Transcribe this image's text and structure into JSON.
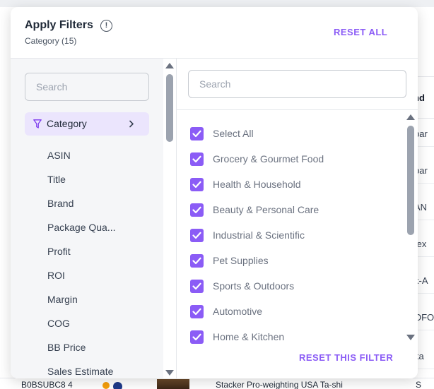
{
  "background": {
    "column_header": "nd",
    "cells": [
      "bar",
      "bar",
      "AN",
      "tex",
      "k-A",
      "OFO",
      "ka",
      "S"
    ],
    "bottom_row_id": "B0BSUBC8 4",
    "bottom_row_text": "Stacker Pro-weighting USA Ta-shi"
  },
  "panel": {
    "title": "Apply Filters",
    "subtitle": "Category (15)",
    "info_icon_glyph": "!",
    "reset_all_label": "RESET ALL",
    "reset_filter_label": "RESET THIS FILTER"
  },
  "left": {
    "search_placeholder": "Search",
    "active_item": "Category",
    "items": [
      "ASIN",
      "Title",
      "Brand",
      "Package Qua...",
      "Profit",
      "ROI",
      "Margin",
      "COG",
      "BB Price",
      "Sales Estimate"
    ]
  },
  "right": {
    "search_placeholder": "Search",
    "options": [
      {
        "label": "Select All",
        "checked": true
      },
      {
        "label": "Grocery & Gourmet Food",
        "checked": true
      },
      {
        "label": "Health & Household",
        "checked": true
      },
      {
        "label": "Beauty & Personal Care",
        "checked": true
      },
      {
        "label": "Industrial & Scientific",
        "checked": true
      },
      {
        "label": "Pet Supplies",
        "checked": true
      },
      {
        "label": "Sports & Outdoors",
        "checked": true
      },
      {
        "label": "Automotive",
        "checked": true
      },
      {
        "label": "Home & Kitchen",
        "checked": true
      }
    ]
  },
  "colors": {
    "accent": "#8b5cf6",
    "active_bg": "#ebe5fd"
  },
  "icons": {
    "info": "info-circle-icon",
    "filter": "funnel-icon",
    "chevron": "chevron-right-icon",
    "check": "checkmark-icon"
  }
}
